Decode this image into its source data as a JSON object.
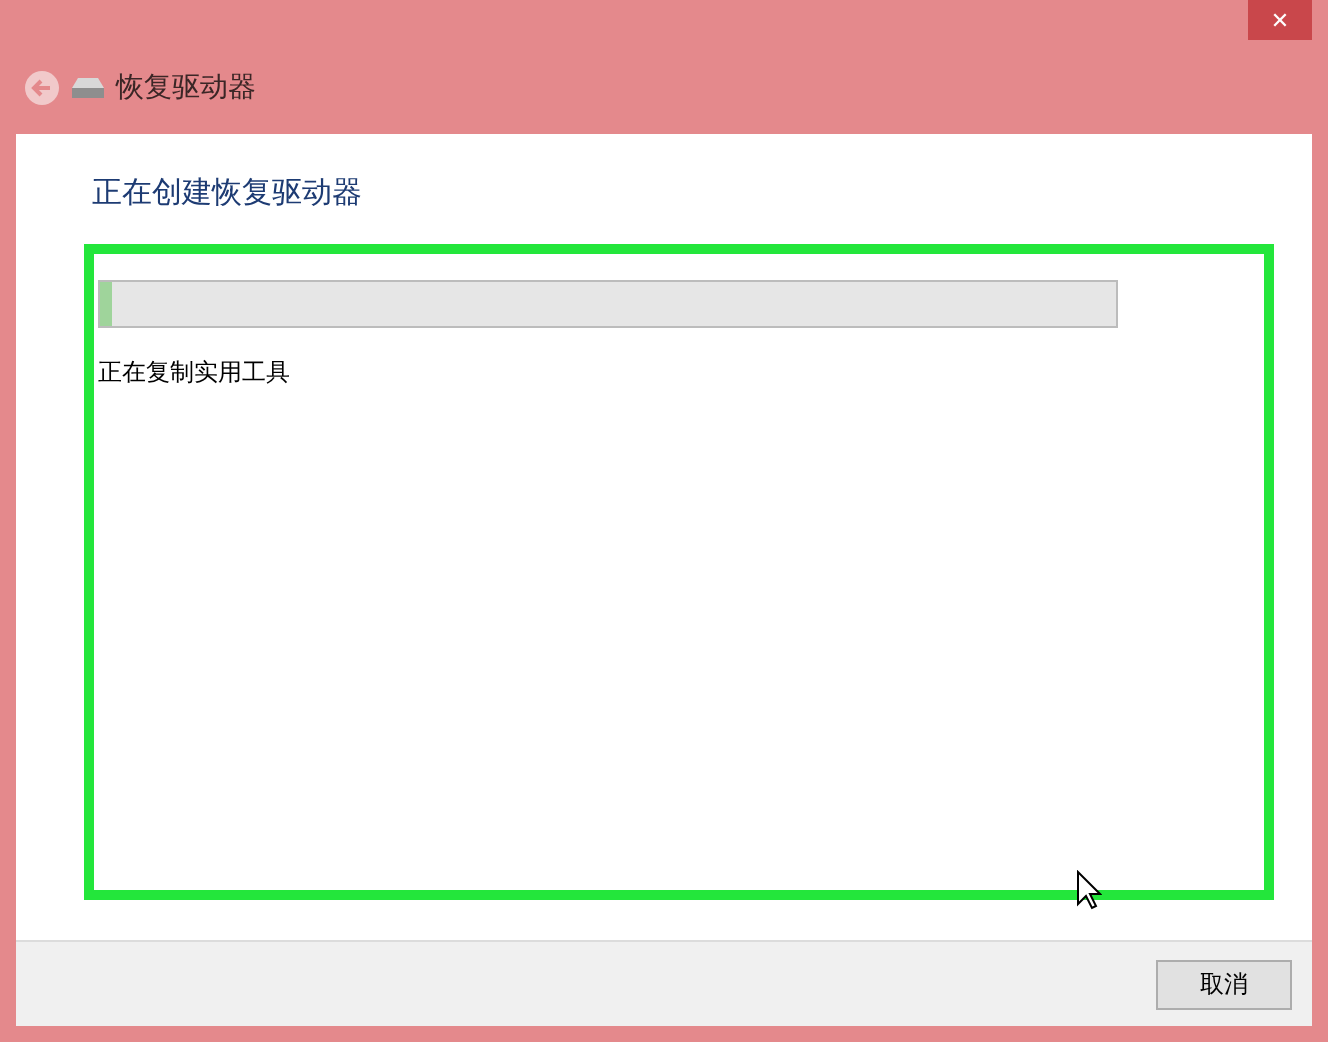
{
  "window": {
    "title": "恢复驱动器",
    "close_glyph": "✕"
  },
  "content": {
    "heading": "正在创建恢复驱动器",
    "progress": {
      "level": 0.012
    },
    "status": "正在复制实用工具",
    "highlighted": true
  },
  "footer": {
    "buttons": [
      "取消"
    ]
  }
}
